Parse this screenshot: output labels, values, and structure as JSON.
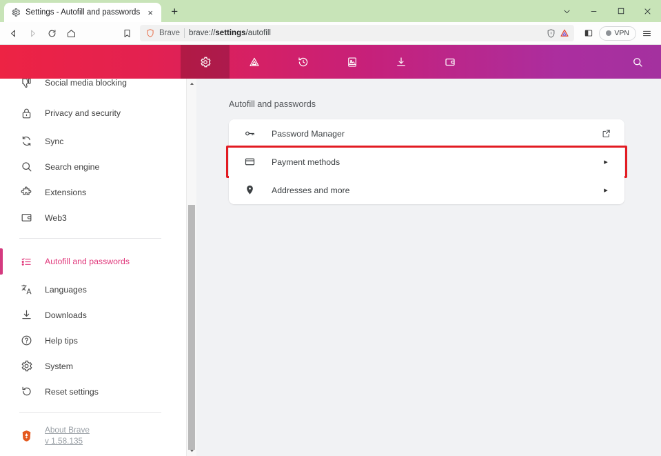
{
  "window": {
    "tab": {
      "title": "Settings - Autofill and passwords",
      "favicon": "gear-icon",
      "close_label": "×"
    },
    "new_tab_label": "+",
    "controls": {
      "chevron_down": "∨",
      "minimize": "–",
      "maximize": "□",
      "close": "✕"
    }
  },
  "toolbar": {
    "back": "back-arrow-icon",
    "forward": "forward-arrow-icon",
    "reload": "reload-icon",
    "home": "home-icon",
    "bookmark": "bookmark-icon",
    "omnibox": {
      "site_label": "Brave",
      "url_prefix": "brave://",
      "url_bold": "settings",
      "url_suffix": "/autofill",
      "full_url": "brave://settings/autofill",
      "shield_icon": "brave-shields-icon",
      "leo_icon": "leo-ai-icon"
    },
    "sidebar_toggle": "sidebar-panel-icon",
    "vpn_label": "VPN",
    "menu": "hamburger-menu-icon"
  },
  "settings_nav": {
    "items": [
      {
        "name": "settings",
        "icon": "gear-icon",
        "active": true
      },
      {
        "name": "shields",
        "icon": "shields-triangle-icon",
        "active": false
      },
      {
        "name": "history",
        "icon": "history-clock-icon",
        "active": false
      },
      {
        "name": "bookmarks",
        "icon": "bookmarks-book-icon",
        "active": false
      },
      {
        "name": "downloads",
        "icon": "download-arrow-icon",
        "active": false
      },
      {
        "name": "wallet",
        "icon": "wallet-icon",
        "active": false
      }
    ],
    "search_icon": "search-icon"
  },
  "sidebar": {
    "items": [
      {
        "label": "Social media blocking",
        "icon": "thumbs-down-icon",
        "active": false,
        "two_line": true
      },
      {
        "label": "Privacy and security",
        "icon": "lock-icon",
        "active": false,
        "two_line": true
      },
      {
        "label": "Sync",
        "icon": "sync-icon",
        "active": false,
        "two_line": false
      },
      {
        "label": "Search engine",
        "icon": "search-icon",
        "active": false,
        "two_line": false
      },
      {
        "label": "Extensions",
        "icon": "puzzle-icon",
        "active": false,
        "two_line": false
      },
      {
        "label": "Web3",
        "icon": "wallet-icon",
        "active": false,
        "two_line": false
      }
    ],
    "items2": [
      {
        "label": "Autofill and passwords",
        "icon": "autofill-list-icon",
        "active": true,
        "two_line": true
      },
      {
        "label": "Languages",
        "icon": "translate-icon",
        "active": false,
        "two_line": false
      },
      {
        "label": "Downloads",
        "icon": "download-arrow-icon",
        "active": false,
        "two_line": false
      },
      {
        "label": "Help tips",
        "icon": "question-circle-icon",
        "active": false,
        "two_line": false
      },
      {
        "label": "System",
        "icon": "gear-icon",
        "active": false,
        "two_line": false
      },
      {
        "label": "Reset settings",
        "icon": "reset-arrow-icon",
        "active": false,
        "two_line": false
      }
    ],
    "about": {
      "logo": "brave-lion-logo",
      "line1": "About Brave",
      "line2": "v 1.58.135"
    },
    "scrollbar": {
      "up_arrow": "▲",
      "down_arrow": "▼"
    }
  },
  "content": {
    "title": "Autofill and passwords",
    "rows": [
      {
        "label": "Password Manager",
        "icon": "key-icon",
        "trailing": "external-link-icon",
        "highlighted": false
      },
      {
        "label": "Payment methods",
        "icon": "credit-card-icon",
        "trailing": "chevron-right-icon",
        "highlighted": true
      },
      {
        "label": "Addresses and more",
        "icon": "location-pin-icon",
        "trailing": "chevron-right-icon",
        "highlighted": false
      }
    ],
    "chevron_glyph": "▸"
  },
  "colors": {
    "titlebar_green": "#c8e4b8",
    "nav_gradient_start": "#ed2344",
    "nav_gradient_end": "#a4319f",
    "accent_pink": "#e0387b",
    "highlight_red": "#e21b22",
    "content_bg": "#f1f2f4"
  }
}
